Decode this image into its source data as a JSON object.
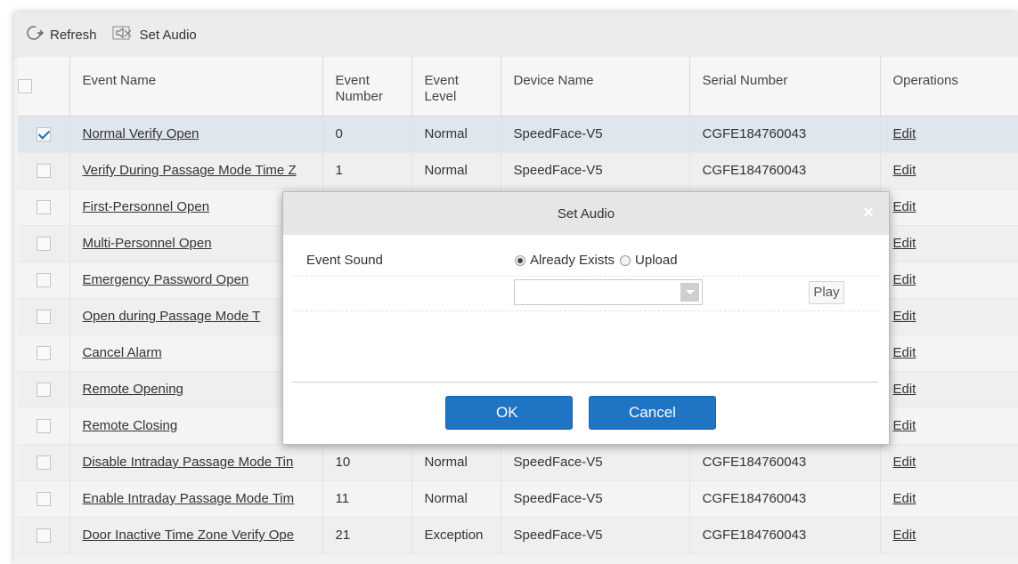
{
  "toolbar": {
    "refresh_label": "Refresh",
    "set_audio_label": "Set Audio"
  },
  "table": {
    "headers": [
      "Event Name",
      "Event\nNumber",
      "Event\nLevel",
      "Device Name",
      "Serial Number",
      "Operations"
    ],
    "rows": [
      {
        "checked": true,
        "name": "Normal Verify Open",
        "number": "0",
        "level": "Normal",
        "device": "SpeedFace-V5",
        "serial": "CGFE184760043",
        "op": "Edit"
      },
      {
        "checked": false,
        "name": "Verify During Passage Mode Time Z",
        "number": "1",
        "level": "Normal",
        "device": "SpeedFace-V5",
        "serial": "CGFE184760043",
        "op": "Edit"
      },
      {
        "checked": false,
        "name": "First-Personnel Open",
        "number": "",
        "level": "",
        "device": "",
        "serial": "",
        "op": "Edit"
      },
      {
        "checked": false,
        "name": "Multi-Personnel Open",
        "number": "",
        "level": "",
        "device": "",
        "serial": "",
        "op": "Edit"
      },
      {
        "checked": false,
        "name": "Emergency Password Open",
        "number": "",
        "level": "",
        "device": "",
        "serial": "",
        "op": "Edit"
      },
      {
        "checked": false,
        "name": "Open during Passage Mode T",
        "number": "",
        "level": "",
        "device": "",
        "serial": "",
        "op": "Edit"
      },
      {
        "checked": false,
        "name": "Cancel Alarm",
        "number": "",
        "level": "",
        "device": "",
        "serial": "",
        "op": "Edit"
      },
      {
        "checked": false,
        "name": "Remote Opening",
        "number": "",
        "level": "",
        "device": "",
        "serial": "",
        "op": "Edit"
      },
      {
        "checked": false,
        "name": "Remote Closing",
        "number": "",
        "level": "",
        "device": "",
        "serial": "",
        "op": "Edit"
      },
      {
        "checked": false,
        "name": "Disable Intraday Passage Mode Tin",
        "number": "10",
        "level": "Normal",
        "device": "SpeedFace-V5",
        "serial": "CGFE184760043",
        "op": "Edit"
      },
      {
        "checked": false,
        "name": "Enable Intraday Passage Mode Tim",
        "number": "11",
        "level": "Normal",
        "device": "SpeedFace-V5",
        "serial": "CGFE184760043",
        "op": "Edit"
      },
      {
        "checked": false,
        "name": "Door Inactive Time Zone Verify Ope",
        "number": "21",
        "level": "Exception",
        "device": "SpeedFace-V5",
        "serial": "CGFE184760043",
        "op": "Edit"
      }
    ]
  },
  "dialog": {
    "title": "Set Audio",
    "close_glyph": "×",
    "event_sound_label": "Event Sound",
    "option_existing": "Already Exists",
    "option_upload": "Upload",
    "selected_option": "Already Exists",
    "sound_select_value": "",
    "play_label": "Play",
    "ok_label": "OK",
    "cancel_label": "Cancel"
  },
  "colors": {
    "level_normal": "#2e7d32",
    "level_exception": "#d9731a",
    "primary_button": "#1f74c4"
  }
}
